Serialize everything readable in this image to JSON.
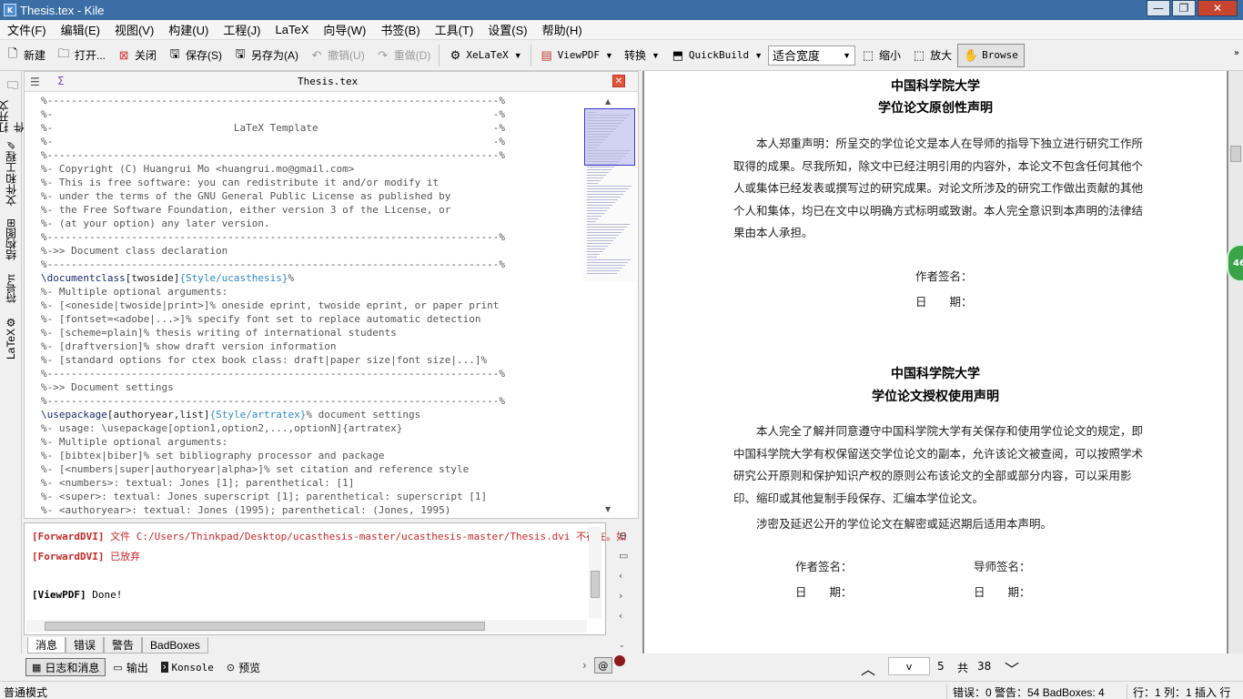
{
  "window": {
    "title": "Thesis.tex - Kile",
    "app_icon": "K"
  },
  "menubar": [
    "文件(F)",
    "编辑(E)",
    "视图(V)",
    "构建(U)",
    "工程(J)",
    "LaTeX",
    "向导(W)",
    "书签(B)",
    "工具(T)",
    "设置(S)",
    "帮助(H)"
  ],
  "toolbar": {
    "new": "新建",
    "open": "打开...",
    "close": "关闭",
    "save": "保存(S)",
    "save_as": "另存为(A)",
    "undo": "撤销(U)",
    "redo": "重做(D)",
    "xelatex": "XeLaTeX",
    "viewpdf": "ViewPDF",
    "convert": "转换",
    "quickbuild": "QuickBuild",
    "zoom_mode": "适合宽度",
    "zoom_out": "缩小",
    "zoom_in": "放大",
    "browse": "Browse"
  },
  "sidebar": [
    "打开文件",
    "文件和工程",
    "结构图",
    "符号",
    "LaTeX"
  ],
  "editor": {
    "tab_title": "Thesis.tex",
    "lines": [
      {
        "t": "%---------------------------------------------------------------------------%",
        "k": "c"
      },
      {
        "t": "%-                                                                         -%",
        "k": "c"
      },
      {
        "t": "%-                              LaTeX Template                             -%",
        "k": "c"
      },
      {
        "t": "%-                                                                         -%",
        "k": "c"
      },
      {
        "t": "%---------------------------------------------------------------------------%",
        "k": "c"
      },
      {
        "t": "%- Copyright (C) Huangrui Mo <huangrui.mo@gmail.com>",
        "k": "c"
      },
      {
        "t": "%- This is free software: you can redistribute it and/or modify it",
        "k": "c"
      },
      {
        "t": "%- under the terms of the GNU General Public License as published by",
        "k": "c"
      },
      {
        "t": "%- the Free Software Foundation, either version 3 of the License, or",
        "k": "c"
      },
      {
        "t": "%- (at your option) any later version.",
        "k": "c"
      },
      {
        "t": "%---------------------------------------------------------------------------%",
        "k": "c"
      },
      {
        "t": "%->> Document class declaration",
        "k": "c"
      },
      {
        "t": "%---------------------------------------------------------------------------%",
        "k": "c"
      },
      {
        "cmd": "\\documentclass",
        "opt": "[twoside]",
        "arg": "{Style/ucasthesis}",
        "rest": "%",
        "k": "x"
      },
      {
        "t": "%- Multiple optional arguments:",
        "k": "c"
      },
      {
        "t": "%- [<oneside|twoside|print>]% oneside eprint, twoside eprint, or paper print",
        "k": "c"
      },
      {
        "t": "%- [fontset=<adobe|...>]% specify font set to replace automatic detection",
        "k": "c"
      },
      {
        "t": "%- [scheme=plain]% thesis writing of international students",
        "k": "c"
      },
      {
        "t": "%- [draftversion]% show draft version information",
        "k": "c"
      },
      {
        "t": "%- [standard options for ctex book class: draft|paper size|font size|...]%",
        "k": "c"
      },
      {
        "t": "%---------------------------------------------------------------------------%",
        "k": "c"
      },
      {
        "t": "%->> Document settings",
        "k": "c"
      },
      {
        "t": "%---------------------------------------------------------------------------%",
        "k": "c"
      },
      {
        "cmd": "\\usepackage",
        "opt": "[authoryear,list]",
        "arg": "{Style/artratex}",
        "rest": "% document settings",
        "k": "x"
      },
      {
        "t": "%- usage: \\usepackage[option1,option2,...,optionN]{artratex}",
        "k": "c"
      },
      {
        "t": "%- Multiple optional arguments:",
        "k": "c"
      },
      {
        "t": "%- [bibtex|biber]% set bibliography processor and package",
        "k": "c"
      },
      {
        "t": "%- [<numbers|super|authoryear|alpha>]% set citation and reference style",
        "k": "c"
      },
      {
        "t": "%- <numbers>: textual: Jones [1]; parenthetical: [1]",
        "k": "c"
      },
      {
        "t": "%- <super>: textual: Jones superscript [1]; parenthetical: superscript [1]",
        "k": "c"
      },
      {
        "t": "%- <authoryear>: textual: Jones (1995); parenthetical: (Jones, 1995)",
        "k": "c"
      }
    ]
  },
  "log": {
    "line1_tag": "[ForwardDVI]",
    "line1_text": " 文件 C:/Users/Thinkpad/Desktop/ucasthesis-master/ucasthesis-master/Thesis.dvi 不存在。如",
    "line2_tag": "[ForwardDVI]",
    "line2_text": " 已放弃",
    "line3_tag": "[ViewPDF]",
    "line3_text": " Done!",
    "tabs": [
      "消息",
      "错误",
      "警告",
      "BadBoxes"
    ]
  },
  "bottom_tabs": [
    "日志和消息",
    "输出",
    "Konsole",
    "预览"
  ],
  "pdf": {
    "sec1_title1": "中国科学院大学",
    "sec1_title2": "学位论文原创性声明",
    "sec1_para": "本人郑重声明：所呈交的学位论文是本人在导师的指导下独立进行研究工作所取得的成果。尽我所知，除文中已经注明引用的内容外，本论文不包含任何其他个人或集体已经发表或撰写过的研究成果。对论文所涉及的研究工作做出贡献的其他个人和集体，均已在文中以明确方式标明或致谢。本人完全意识到本声明的法律结果由本人承担。",
    "sec1_sign": "作者签名：",
    "sec1_date": "日　　期：",
    "sec2_title1": "中国科学院大学",
    "sec2_title2": "学位论文授权使用声明",
    "sec2_para": "本人完全了解并同意遵守中国科学院大学有关保存和使用学位论文的规定，即中国科学院大学有权保留送交学位论文的副本，允许该论文被查阅，可以按照学术研究公开原则和保护知识产权的原则公布该论文的全部或部分内容，可以采用影印、缩印或其他复制手段保存、汇编本学位论文。",
    "sec2_para2": "涉密及延迟公开的学位论文在解密或延迟期后适用本声明。",
    "sec2_author_sign": "作者签名：",
    "sec2_advisor_sign": "导师签名：",
    "sec2_date_l": "日　　期：",
    "sec2_date_r": "日　　期：",
    "badge": "46"
  },
  "pdf_nav": {
    "page_box": "v",
    "page": "5",
    "of": "共",
    "total": "38"
  },
  "status": {
    "mode": "普通模式",
    "errors": "错误：0  警告：54  BadBoxes: 4",
    "position": "行：1 列：1  插入  行"
  }
}
